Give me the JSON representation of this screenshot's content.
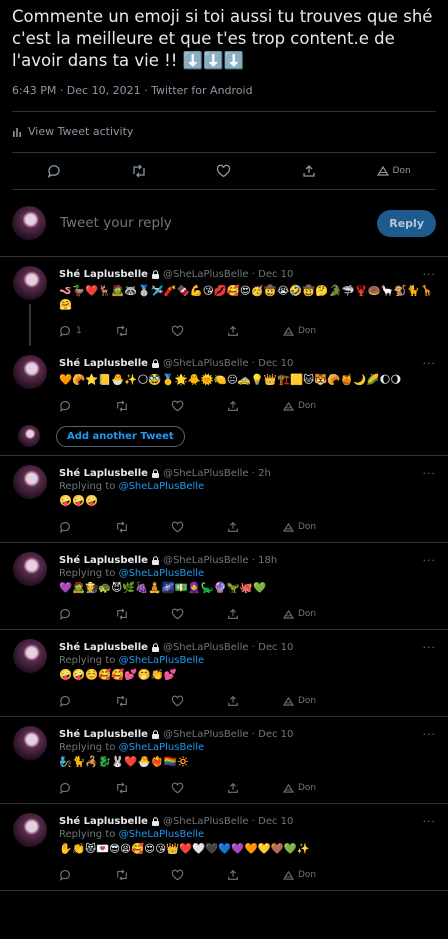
{
  "main_tweet": {
    "text": "Commente un emoji si toi aussi tu trouves que shé c'est la meilleure et que t'es trop content.e de l'avoir dans ta vie !! ⬇️⬇️⬇️",
    "meta": "6:43 PM · Dec 10, 2021 · Twitter for Android",
    "activity_label": "View Tweet activity",
    "share_label": "Don"
  },
  "compose": {
    "placeholder": "Tweet your reply",
    "button": "Reply"
  },
  "add_tweet_label": "Add another Tweet",
  "replies": [
    {
      "name": "Shé Laplusbelle",
      "handle": "@SheLaPlusBelle",
      "date": "· Dec 10",
      "replying": "",
      "content": "🪱🦆❤️🦌🧟🦝🥈🛩️🧨🍫💪😘💋🥰😍🥳🤠😭🤣🤠🤔🐊🦈🦞🍩🦙🐒🐈🦒🤗",
      "reply_count": "1",
      "share": "Don"
    },
    {
      "name": "Shé Laplusbelle",
      "handle": "@SheLaPlusBelle",
      "date": "· Dec 10",
      "replying": "",
      "content": "🧡🥐⭐📒🐣✨🌕🥸🥇🌟🐥🌞🍋😐🚕💡👑🏗️🟨🐱🐯🥐🍯🌙🌽🌔🌖",
      "reply_count": "",
      "share": "Don"
    },
    {
      "name": "Shé Laplusbelle",
      "handle": "@SheLaPlusBelle",
      "date": "· 2h",
      "replying": "@SheLaPlusBelle",
      "content": "🤪🤪🤪",
      "reply_count": "",
      "share": "Don"
    },
    {
      "name": "Shé Laplusbelle",
      "handle": "@SheLaPlusBelle",
      "date": "· 18h",
      "replying": "@SheLaPlusBelle",
      "content": "💜🧟👩‍🌾🐢😈🌿🍇🧘🌌💵🧕🦕🔮🦖🐙💚",
      "reply_count": "",
      "share": "Don"
    },
    {
      "name": "Shé Laplusbelle",
      "handle": "@SheLaPlusBelle",
      "date": "· Dec 10",
      "replying": "@SheLaPlusBelle",
      "content": "🤪🤪☺️🥰🥰💕🤭👏💕",
      "reply_count": "",
      "share": "Don"
    },
    {
      "name": "Shé Laplusbelle",
      "handle": "@SheLaPlusBelle",
      "date": "· Dec 10",
      "replying": "@SheLaPlusBelle",
      "content": "🧞🐈🦂🐉🐰❤️🐣❤️‍🔥🏳️‍🌈🔅",
      "reply_count": "",
      "share": "Don"
    },
    {
      "name": "Shé Laplusbelle",
      "handle": "@SheLaPlusBelle",
      "date": "· Dec 10",
      "replying": "@SheLaPlusBelle",
      "content": "✋👏😻💌😎😫🥰😍😘👑❤️🤍🖤💙💜🧡💛🤎💚✨",
      "reply_count": "",
      "share": "Don"
    }
  ],
  "replying_prefix": "Replying to"
}
